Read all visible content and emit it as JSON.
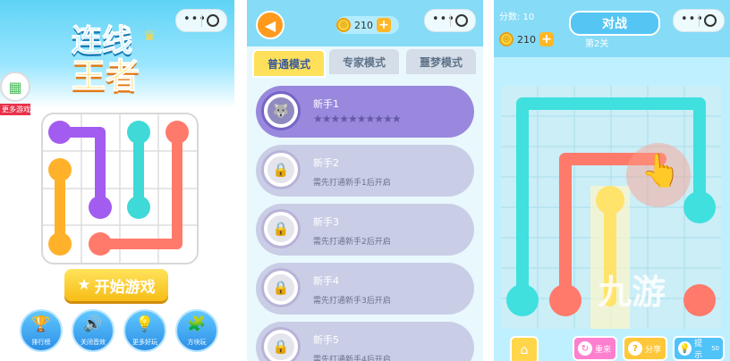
{
  "panel1": {
    "logo_line1": "连线",
    "logo_line2": "王者",
    "more_games_label": "更多游戏",
    "start_button": "开始游戏",
    "bottom_buttons": [
      {
        "label": "排行榜",
        "icon": "trophy-icon"
      },
      {
        "label": "关闭音效",
        "icon": "speaker-icon"
      },
      {
        "label": "更多好玩",
        "icon": "lightbulb-icon"
      },
      {
        "label": "方块玩",
        "icon": "blocks-icon"
      }
    ],
    "line_colors": {
      "purple": "#a35cf0",
      "cyan": "#3fd9d8",
      "coral": "#ff7a6a",
      "orange": "#ffb12a"
    }
  },
  "panel2": {
    "coins": "210",
    "tabs": [
      "普通模式",
      "专家模式",
      "噩梦模式"
    ],
    "levels": [
      {
        "name": "新手1",
        "sub": "",
        "stars": "★★★★★★★★★★",
        "locked": false
      },
      {
        "name": "新手2",
        "sub": "需先打通新手1后开启",
        "locked": true
      },
      {
        "name": "新手3",
        "sub": "需先打通新手2后开启",
        "locked": true
      },
      {
        "name": "新手4",
        "sub": "需先打通新手3后开启",
        "locked": true
      },
      {
        "name": "新手5",
        "sub": "需先打通新手4后开启",
        "locked": true
      }
    ]
  },
  "panel3": {
    "score_label": "分数: 10",
    "coins": "210",
    "battle_title": "对战",
    "level_label": "第2关",
    "watermark": "九游",
    "buttons": {
      "restart": "重来",
      "share": "分享",
      "hint": "提示",
      "hint_count": "50"
    }
  },
  "colors": {
    "accent": "#ffb726",
    "sky": "#86dbf6",
    "locked_card": "#c9cee6",
    "active_card": "#9988dd"
  }
}
